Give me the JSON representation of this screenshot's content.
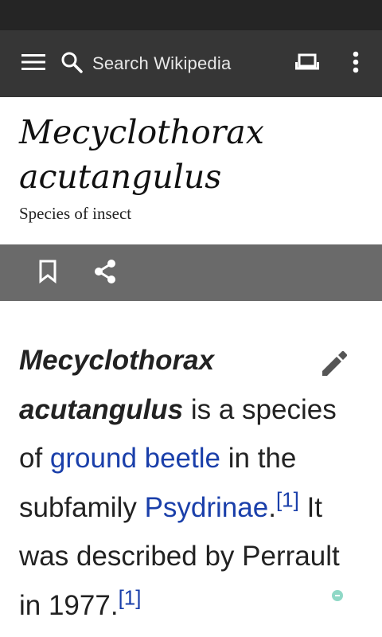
{
  "toolbar": {
    "search_placeholder": "Search Wikipedia"
  },
  "article": {
    "title": "Mecyclothorax acutangulus",
    "description": "Species of insect",
    "lead": {
      "bold_name": "Mecyclothorax acutangulus",
      "t1": " is a species of ",
      "link1": "ground beetle",
      "t2": " in the subfamily ",
      "link2": "Psydrinae",
      "t3": ".",
      "ref1": "[1]",
      "t4": " It was described by Perrault in ",
      "t5": "1977.",
      "ref2": "[1]"
    }
  },
  "icons": {
    "menu": "menu-icon",
    "search": "search-icon",
    "tabs": "tabs-icon",
    "overflow": "overflow-icon",
    "bookmark": "bookmark-icon",
    "share": "share-icon",
    "edit": "edit-icon"
  },
  "colors": {
    "statusbar": "#252525",
    "toolbar": "#363636",
    "actionbar": "#6a6a6a",
    "link": "#1a3faa",
    "text": "#222222"
  }
}
